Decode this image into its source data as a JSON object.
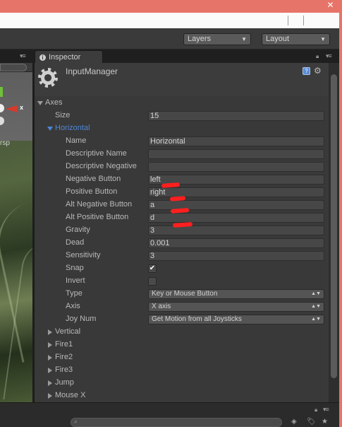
{
  "toolbar": {
    "layers_label": "Layers",
    "layout_label": "Layout"
  },
  "tabs": {
    "inspector_label": "Inspector"
  },
  "scene": {
    "axis_label": "x",
    "persp_label": "rsp"
  },
  "inspector": {
    "title": "InputManager",
    "axes_label": "Axes",
    "size_label": "Size",
    "size_value": "15",
    "horizontal_label": "Horizontal",
    "fields": [
      {
        "label": "Name",
        "value": "Horizontal"
      },
      {
        "label": "Descriptive Name",
        "value": ""
      },
      {
        "label": "Descriptive Negative",
        "value": ""
      },
      {
        "label": "Negative Button",
        "value": "left"
      },
      {
        "label": "Positive Button",
        "value": "right"
      },
      {
        "label": "Alt Negative Button",
        "value": "a"
      },
      {
        "label": "Alt Positive Button",
        "value": "d"
      },
      {
        "label": "Gravity",
        "value": "3"
      },
      {
        "label": "Dead",
        "value": "0.001"
      },
      {
        "label": "Sensitivity",
        "value": "3"
      }
    ],
    "snap_label": "Snap",
    "snap_checked": true,
    "invert_label": "Invert",
    "invert_checked": false,
    "type_label": "Type",
    "type_value": "Key or Mouse Button",
    "axis_label": "Axis",
    "axis_value": "X axis",
    "joynum_label": "Joy Num",
    "joynum_value": "Get Motion from all Joysticks",
    "collapsed_axes": [
      "Vertical",
      "Fire1",
      "Fire2",
      "Fire3",
      "Jump",
      "Mouse X"
    ]
  },
  "colors": {
    "window_frame": "#e77468",
    "panel_bg": "#393939",
    "foldout_blue": "#4d86d6",
    "annotation_red": "#ff1f1f"
  }
}
